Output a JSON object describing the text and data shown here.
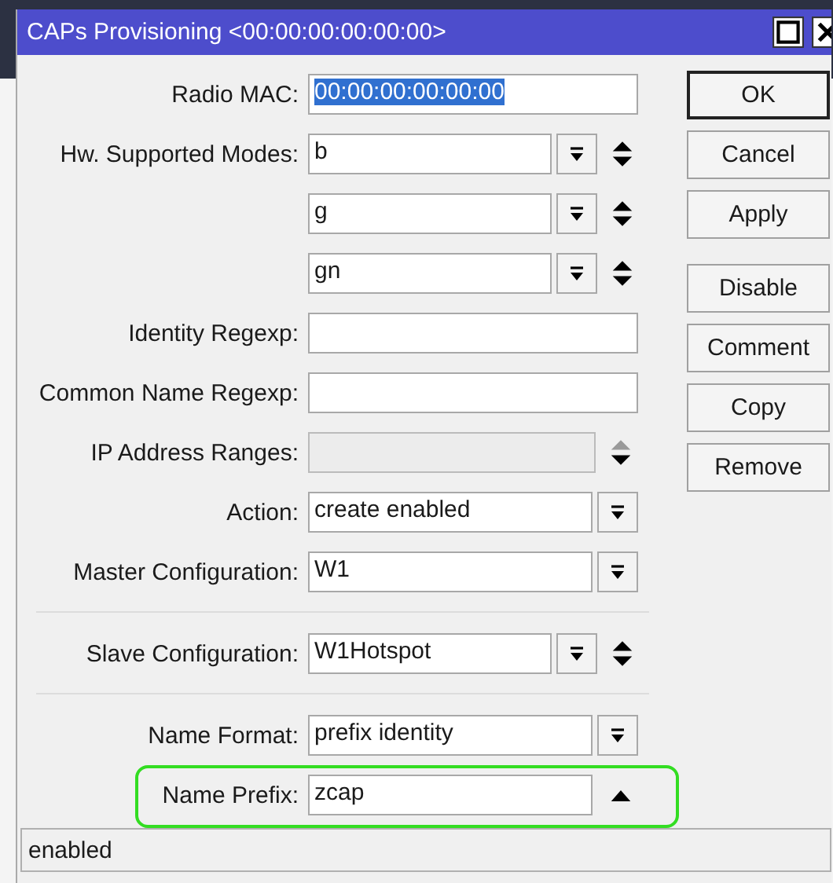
{
  "window": {
    "title": "CAPs Provisioning <00:00:00:00:00:00>"
  },
  "fields": [
    {
      "label": "Radio MAC:",
      "kind": "text",
      "value": "00:00:00:00:00:00",
      "value_selected": true
    },
    {
      "label": "Hw. Supported Modes:",
      "kind": "list",
      "value": "b"
    },
    {
      "kind": "list",
      "value": "g"
    },
    {
      "kind": "list",
      "value": "gn"
    },
    {
      "label": "Identity Regexp:",
      "kind": "text"
    },
    {
      "label": "Common Name Regexp:",
      "kind": "text"
    },
    {
      "label": "IP Address Ranges:",
      "kind": "disabled_list"
    },
    {
      "label": "Action:",
      "kind": "select",
      "value": "create enabled"
    },
    {
      "label": "Master Configuration:",
      "kind": "select",
      "value": "W1"
    },
    {
      "label": "Slave Configuration:",
      "kind": "list",
      "value": "W1Hotspot",
      "divider_before": true
    },
    {
      "label": "Name Format:",
      "kind": "select",
      "value": "prefix identity",
      "divider_before": true
    },
    {
      "label": "Name Prefix:",
      "kind": "expand",
      "value": "zcap",
      "highlighted": true
    }
  ],
  "button_groups": [
    [
      {
        "label": "OK",
        "default": true
      },
      {
        "label": "Cancel",
        "default": false
      },
      {
        "label": "Apply",
        "default": false
      }
    ],
    [
      {
        "label": "Disable",
        "default": false
      },
      {
        "label": "Comment",
        "default": false
      },
      {
        "label": "Copy",
        "default": false
      },
      {
        "label": "Remove",
        "default": false
      }
    ]
  ],
  "status_bar": {
    "text": "enabled"
  }
}
